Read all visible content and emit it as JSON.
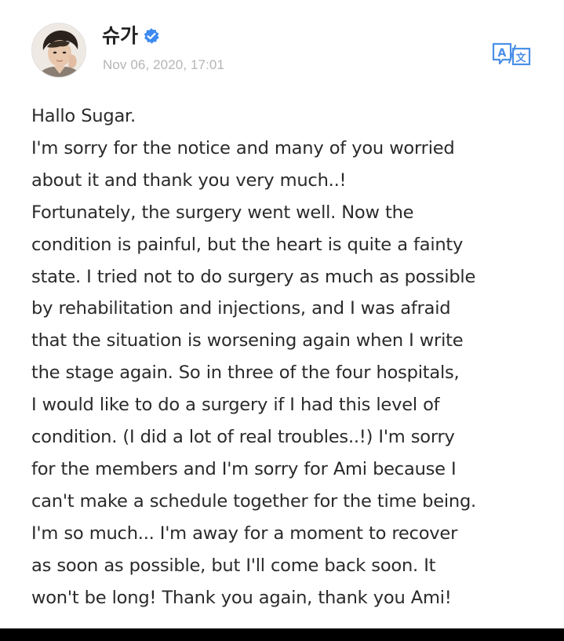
{
  "post": {
    "author": "슈가",
    "verified_icon": "verified-check-icon",
    "timestamp": "Nov 06, 2020, 17:01",
    "translate_icon": "translate-icon",
    "lines": [
      "Hallo Sugar.",
      "I'm sorry for the notice and many of you worried",
      "about it and thank you very much..!",
      "Fortunately, the surgery went well. Now the",
      "condition is painful, but the heart is quite a fainty",
      "state. I tried not to do surgery as much as possible",
      "by rehabilitation and injections, and I was afraid",
      "that the situation is worsening again when I write",
      "the stage again. So in three of the four hospitals,",
      "I would like to do a surgery if I had this level of",
      "condition. (I did a lot of real troubles..!) I'm sorry",
      "for the members and I'm sorry for Ami because I",
      "can't make a schedule together for the time being.",
      "I'm so much... I'm away for a moment to recover",
      "as soon as possible, but I'll come back soon. It",
      "won't be long! Thank you again, thank you Ami!"
    ]
  },
  "colors": {
    "verified": "#3d8bf2",
    "translate": "#4a8fe7",
    "timestamp": "#b5b5b5",
    "text": "#2a2a2a"
  }
}
